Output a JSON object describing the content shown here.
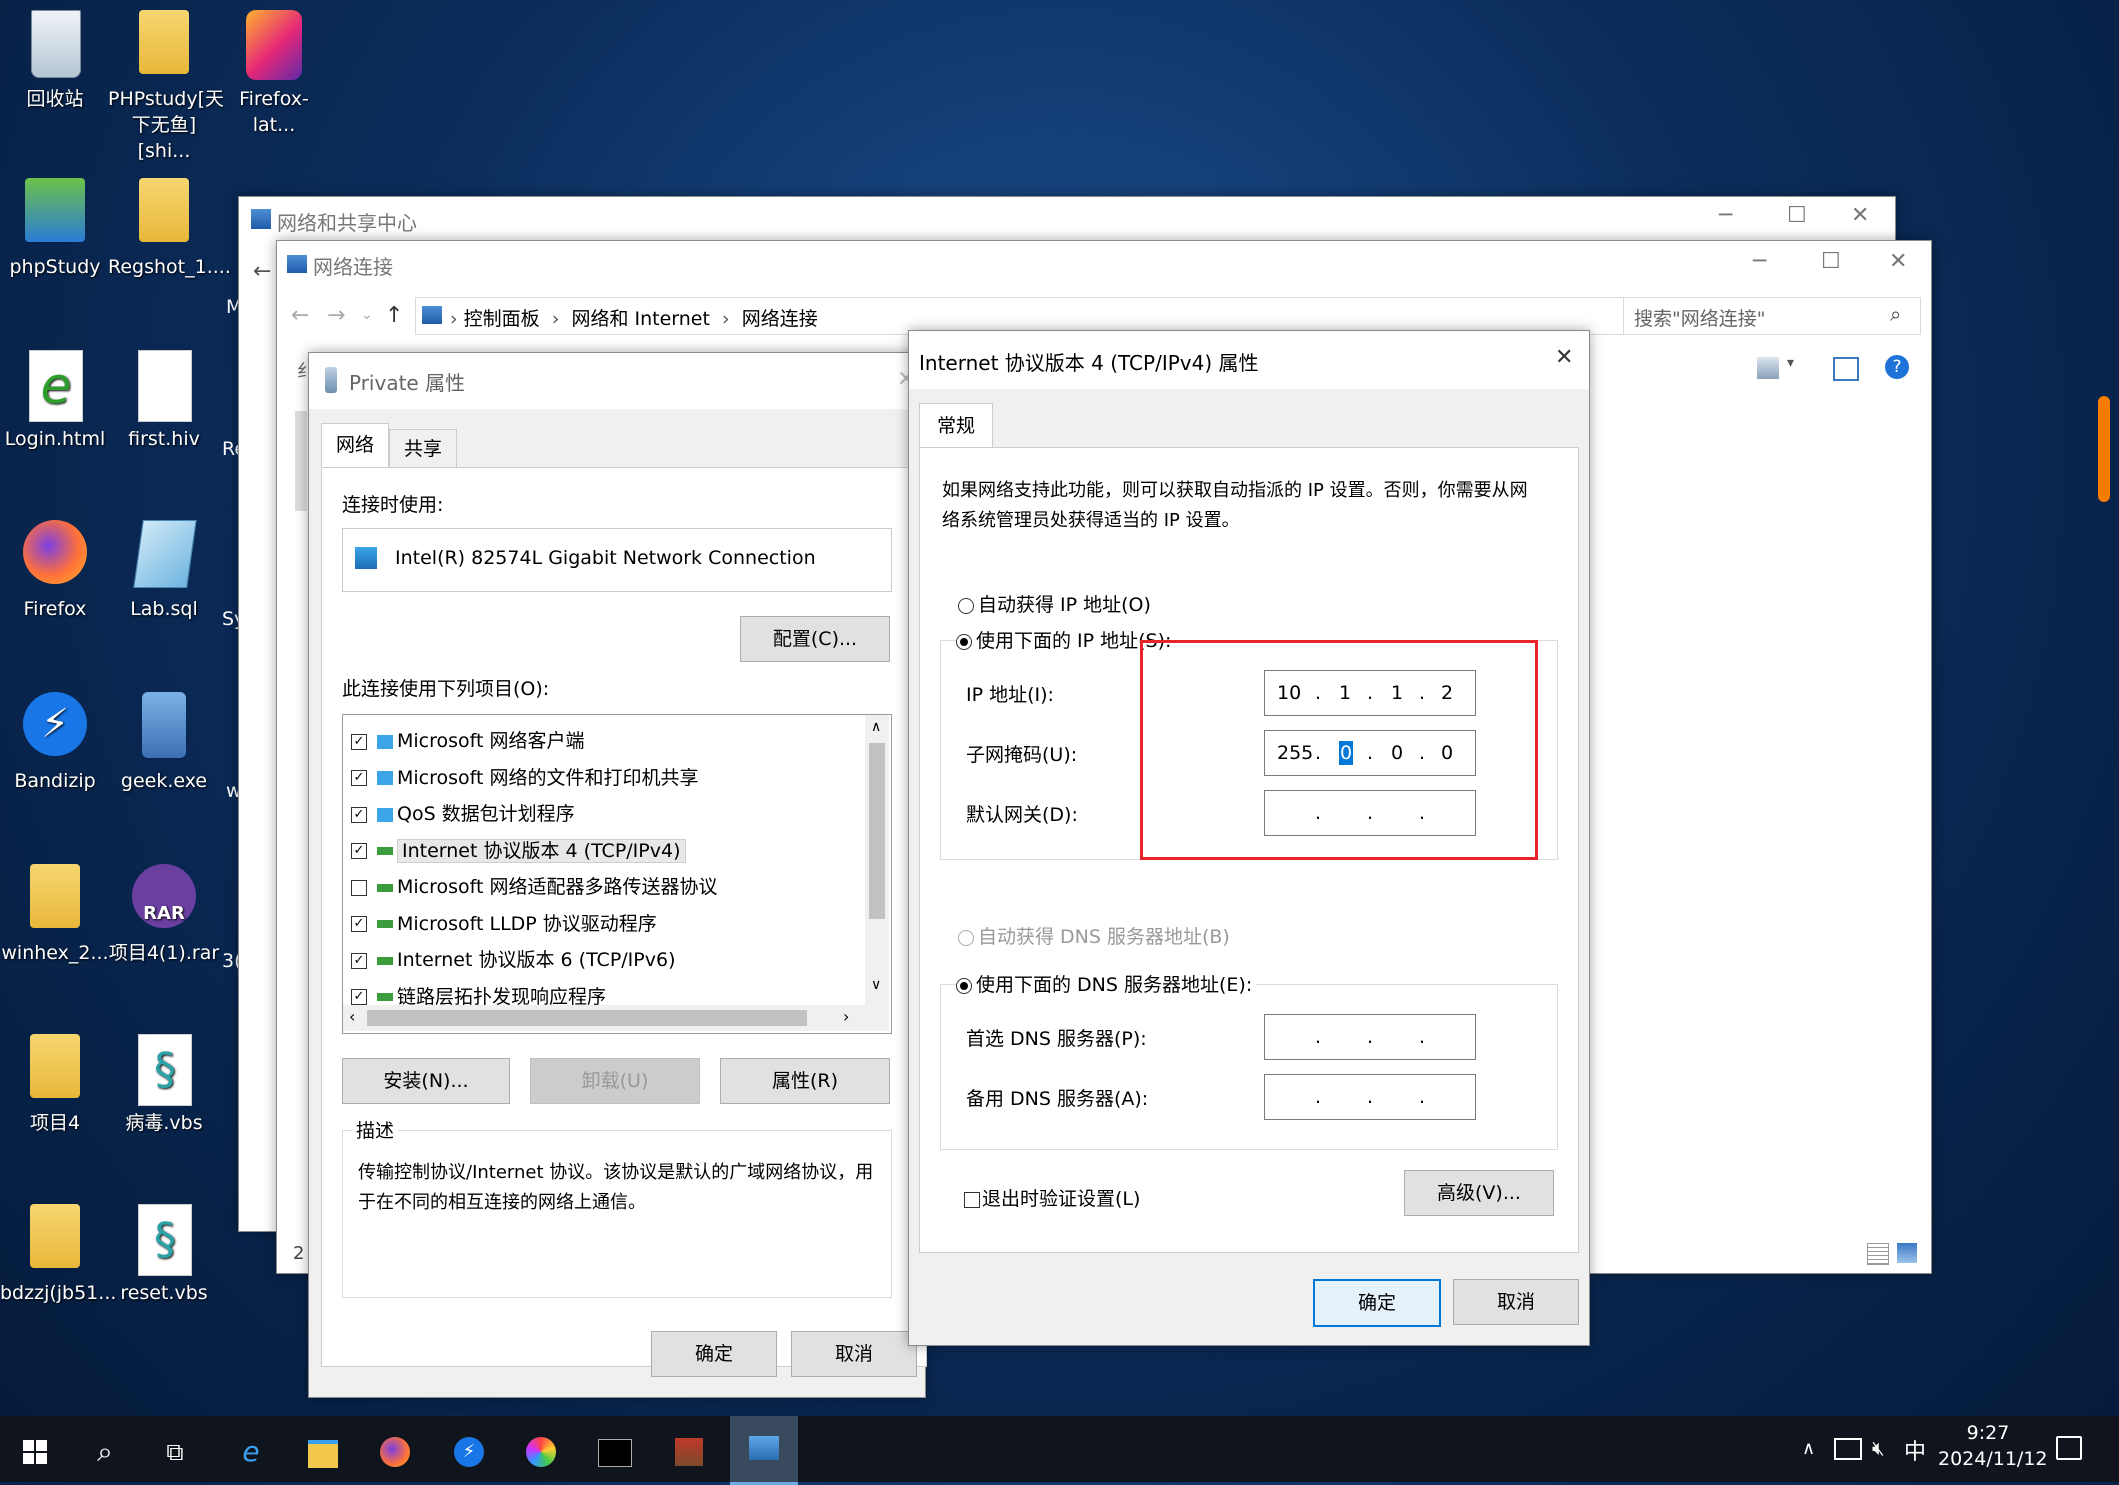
{
  "desktop": {
    "icons": [
      {
        "label": "回收站"
      },
      {
        "label": "PHPstudy[天下无鱼][shi..."
      },
      {
        "label": "Firefox-lat..."
      },
      {
        "label": "phpStudy"
      },
      {
        "label": "Regshot_1...."
      },
      {
        "label": "Login.html"
      },
      {
        "label": "first.hiv"
      },
      {
        "label": "Firefox"
      },
      {
        "label": "Lab.sql"
      },
      {
        "label": "Bandizip"
      },
      {
        "label": "geek.exe"
      },
      {
        "label": "winhex_2..."
      },
      {
        "label": "项目4(1).rar"
      },
      {
        "label": "项目4"
      },
      {
        "label": "病毒.vbs"
      },
      {
        "label": "bdzzj(jb51..."
      },
      {
        "label": "reset.vbs"
      }
    ],
    "partial_labels": {
      "m": "M",
      "re": "Re",
      "sy": "Sy",
      "w": "w",
      "n3": "3("
    }
  },
  "network_center": {
    "title": "网络和共享中心"
  },
  "net_connections": {
    "title": "网络连接",
    "breadcrumb": [
      "控制面板",
      "网络和 Internet",
      "网络连接"
    ],
    "search_placeholder": "搜索\"网络连接\"",
    "status_num": "2",
    "partial_left": "纟"
  },
  "private_props": {
    "title": "Private 属性",
    "tabs": [
      "网络",
      "共享"
    ],
    "connect_using_label": "连接时使用:",
    "adapter": "Intel(R) 82574L Gigabit Network Connection",
    "configure_button": "配置(C)...",
    "items_label": "此连接使用下列项目(O):",
    "items": [
      {
        "label": "Microsoft 网络客户端",
        "checked": true
      },
      {
        "label": "Microsoft 网络的文件和打印机共享",
        "checked": true
      },
      {
        "label": "QoS 数据包计划程序",
        "checked": true
      },
      {
        "label": "Internet 协议版本 4 (TCP/IPv4)",
        "checked": true
      },
      {
        "label": "Microsoft 网络适配器多路传送器协议",
        "checked": false
      },
      {
        "label": "Microsoft LLDP 协议驱动程序",
        "checked": true
      },
      {
        "label": "Internet 协议版本 6 (TCP/IPv6)",
        "checked": true
      },
      {
        "label": "链路层拓扑发现响应程序",
        "checked": true
      }
    ],
    "install_button": "安装(N)...",
    "uninstall_button": "卸载(U)",
    "properties_button": "属性(R)",
    "description_title": "描述",
    "description_text": "传输控制协议/Internet 协议。该协议是默认的广域网络协议，用于在不同的相互连接的网络上通信。",
    "ok_button": "确定",
    "cancel_button": "取消"
  },
  "ipv4_props": {
    "title": "Internet 协议版本 4 (TCP/IPv4) 属性",
    "tab": "常规",
    "intro": "如果网络支持此功能，则可以获取自动指派的 IP 设置。否则，你需要从网络系统管理员处获得适当的 IP 设置。",
    "auto_ip_label": "自动获得 IP 地址(O)",
    "manual_ip_label": "使用下面的 IP 地址(S):",
    "ip_label": "IP 地址(I):",
    "ip_value": [
      "10",
      "1",
      "1",
      "2"
    ],
    "mask_label": "子网掩码(U):",
    "mask_value": [
      "255",
      "0",
      "0",
      "0"
    ],
    "gateway_label": "默认网关(D):",
    "auto_dns_label": "自动获得 DNS 服务器地址(B)",
    "manual_dns_label": "使用下面的 DNS 服务器地址(E):",
    "preferred_dns_label": "首选 DNS 服务器(P):",
    "alternate_dns_label": "备用 DNS 服务器(A):",
    "validate_label": "退出时验证设置(L)",
    "advanced_button": "高级(V)...",
    "ok_button": "确定",
    "cancel_button": "取消",
    "highlight_color": "#e8242a"
  },
  "taskbar": {
    "time": "9:27",
    "date": "2024/11/12",
    "ime": "中"
  }
}
